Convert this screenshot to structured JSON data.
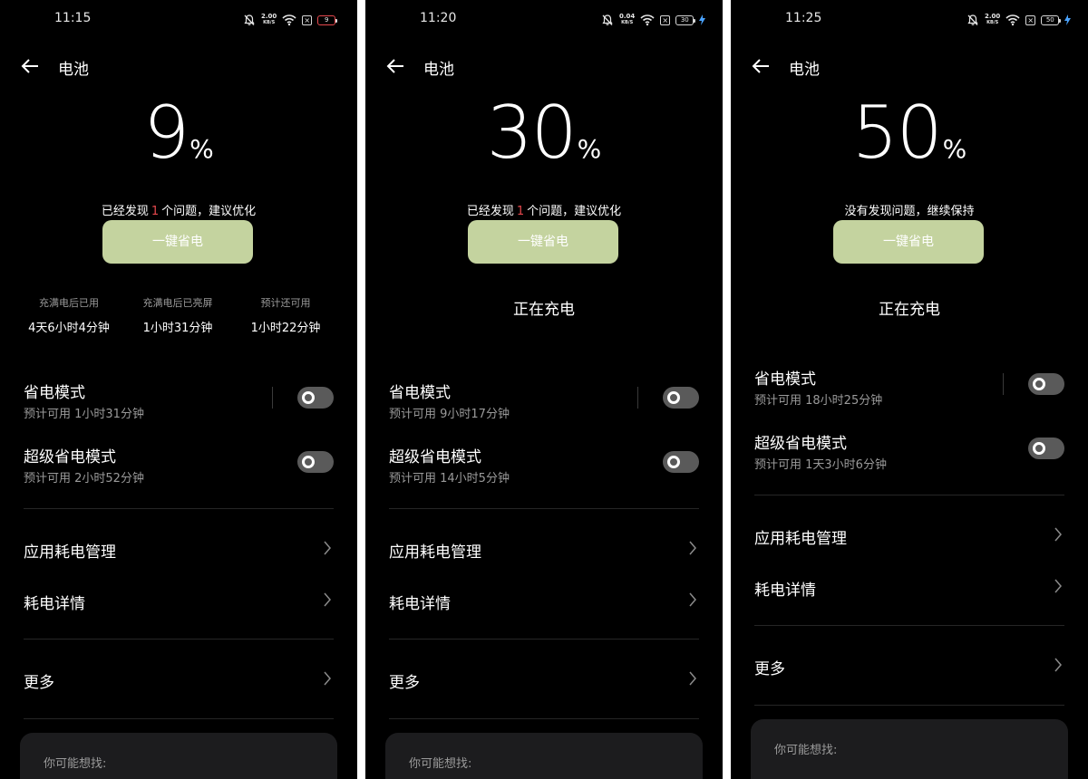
{
  "screens": [
    {
      "time": "11:15",
      "net_speed": "2.00",
      "net_unit": "KB/S",
      "battery_level": "9",
      "charging_icon": false,
      "title": "电池",
      "percent": "9",
      "percent_sign": "%",
      "issue_pre": "已经发现",
      "issue_count": "1",
      "issue_post": "个问题，建议优化",
      "issue_text": "",
      "save_button": "一键省电",
      "stats": [
        {
          "label": "充满电后已用",
          "value": "4天6小时4分钟"
        },
        {
          "label": "充满电后已亮屏",
          "value": "1小时31分钟"
        },
        {
          "label": "预计还可用",
          "value": "1小时22分钟"
        }
      ],
      "charging_text": "",
      "power_saving": {
        "title": "省电模式",
        "sub": "预计可用 1小时31分钟",
        "on": false
      },
      "super_saving": {
        "title": "超级省电模式",
        "sub": "预计可用 2小时52分钟",
        "on": false
      },
      "menu": {
        "app_usage": "应用耗电管理",
        "details": "耗电详情",
        "more": "更多"
      },
      "suggest_label": "你可能想找:"
    },
    {
      "time": "11:20",
      "net_speed": "0.04",
      "net_unit": "KB/S",
      "battery_level": "30",
      "charging_icon": true,
      "title": "电池",
      "percent": "30",
      "percent_sign": "%",
      "issue_pre": "已经发现",
      "issue_count": "1",
      "issue_post": "个问题，建议优化",
      "issue_text": "",
      "save_button": "一键省电",
      "stats": [],
      "charging_text": "正在充电",
      "power_saving": {
        "title": "省电模式",
        "sub": "预计可用 9小时17分钟",
        "on": false
      },
      "super_saving": {
        "title": "超级省电模式",
        "sub": "预计可用 14小时5分钟",
        "on": false
      },
      "menu": {
        "app_usage": "应用耗电管理",
        "details": "耗电详情",
        "more": "更多"
      },
      "suggest_label": "你可能想找:"
    },
    {
      "time": "11:25",
      "net_speed": "2.00",
      "net_unit": "KB/S",
      "battery_level": "50",
      "charging_icon": true,
      "title": "电池",
      "percent": "50",
      "percent_sign": "%",
      "issue_pre": "",
      "issue_count": "",
      "issue_post": "",
      "issue_text": "没有发现问题，继续保持",
      "save_button": "一键省电",
      "stats": [],
      "charging_text": "正在充电",
      "power_saving": {
        "title": "省电模式",
        "sub": "预计可用 18小时25分钟",
        "on": false
      },
      "super_saving": {
        "title": "超级省电模式",
        "sub": "预计可用 1天3小时6分钟",
        "on": false
      },
      "menu": {
        "app_usage": "应用耗电管理",
        "details": "耗电详情",
        "more": "更多"
      },
      "suggest_label": "你可能想找:"
    }
  ],
  "colors": {
    "background": "#000000",
    "accent_button": "#c4d39f",
    "issue_highlight": "#e5484d",
    "secondary_text": "#9a9a9a",
    "toggle_off": "#5a5a5a",
    "card": "#1c1c1e",
    "charging_bolt": "#4aa3ff"
  },
  "icons": [
    "back-arrow-icon",
    "bell-muted-icon",
    "wifi-icon",
    "sim-off-icon",
    "battery-icon",
    "charging-bolt-icon",
    "chevron-right-icon",
    "toggle-switch"
  ]
}
